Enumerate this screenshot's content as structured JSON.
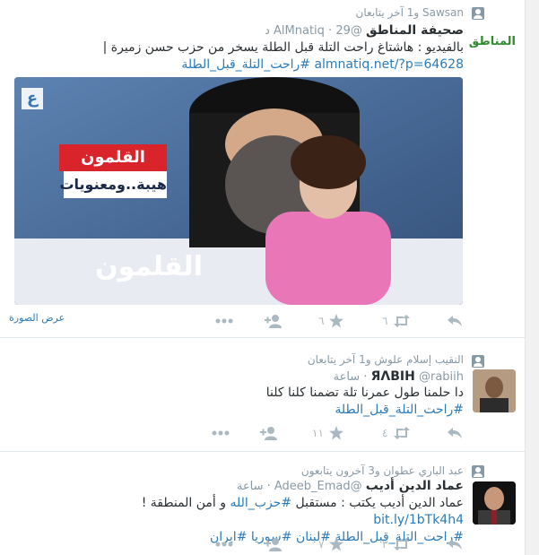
{
  "colors": {
    "link": "#2b7bb9",
    "meta": "#8899a6",
    "icon": "#aab8c2",
    "text": "#292f33"
  },
  "tweets": [
    {
      "context": "Sawsan و1 آخر يتابعان",
      "fullname": "صحيفة المناطق",
      "username": "@AlMnatiq",
      "time": "29 د",
      "text": "بالفيديو : هاشتاغ راحت التلة قبل الطلة يسخر من حزب حسن زميرة |",
      "link": "almnatiq.net/?p=64628",
      "hashtag": "#راحت_التلة_قبل_الطلة",
      "view_photo": "عرض الصورة",
      "logo_text": "المناطق",
      "media": {
        "channel_logo": "ع",
        "banner_red": "القلمون",
        "banner_white": "هيبة..ومعنويات",
        "banner_bottom": "القلمون"
      },
      "retweets": "٦",
      "favorites": "٦"
    },
    {
      "context": "النقيب إسلام علوش و1 آخر يتابعان",
      "fullname": "ЯΛBIH",
      "username": "@rabiih",
      "time": "ساعة",
      "text": "دا حلمنا طول عمرنا تلة تضمنا كلنا كلنا",
      "hashtag": "#راحت_التلة_قبل_الطلة",
      "retweets": "٤",
      "favorites": "١١"
    },
    {
      "context": "عبد الباري عطوان و3 آخرون يتابعون",
      "fullname": "عماد الدين أديب",
      "username": "@Adeeb_Emad",
      "time": "ساعة",
      "text_before": "عماد الدين أديب يكتب : مستقبل",
      "hashtag_inline": "#حزب_الله",
      "text_after": "و أمن المنطقة !",
      "link": "bit.ly/1bTk4h4",
      "hashtags": "#راحت_التلة_قبل_الطلة #لبنان #سوريا #ايران",
      "retweets": "٣",
      "favorites": "٧"
    }
  ]
}
